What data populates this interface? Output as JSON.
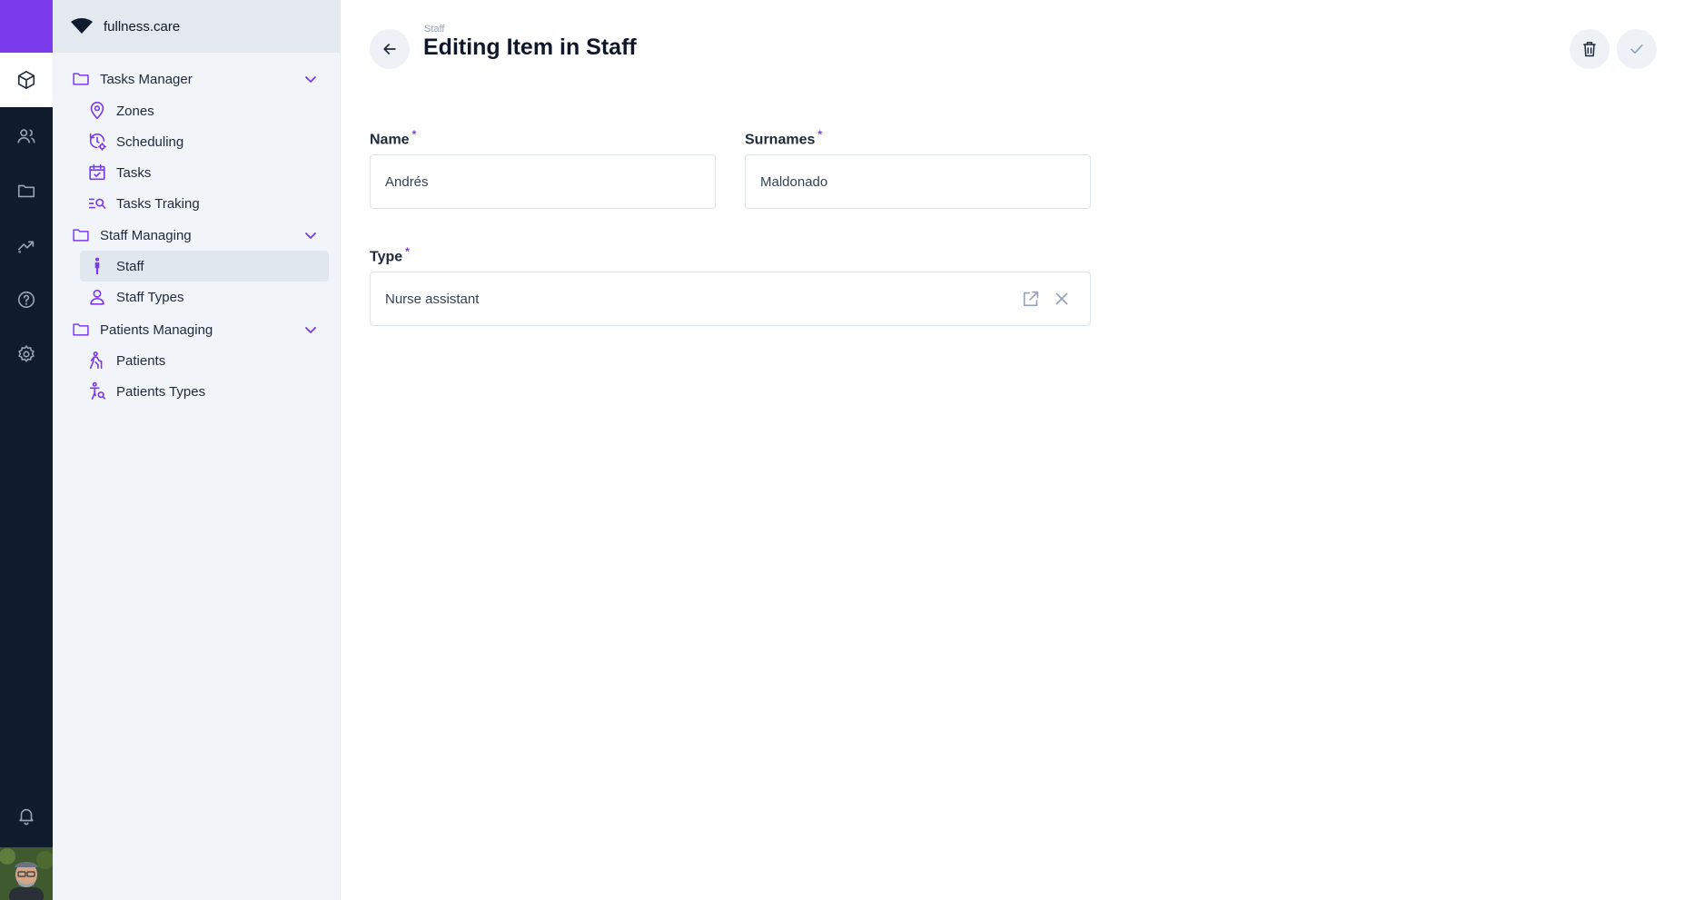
{
  "rail": {
    "items": [
      {
        "icon": "cube-icon",
        "active": true
      },
      {
        "icon": "users-icon",
        "active": false
      },
      {
        "icon": "folder-icon",
        "active": false
      },
      {
        "icon": "analytics-icon",
        "active": false
      },
      {
        "icon": "help-icon",
        "active": false
      },
      {
        "icon": "settings-icon",
        "active": false
      }
    ],
    "bottom": {
      "bell": "bell-icon",
      "avatar": "user-avatar"
    }
  },
  "sidebar": {
    "org": "fullness.care",
    "groups": [
      {
        "label": "Tasks Manager",
        "items": [
          {
            "label": "Zones",
            "icon": "map-pin-icon"
          },
          {
            "label": "Scheduling",
            "icon": "clock-gear-icon"
          },
          {
            "label": "Tasks",
            "icon": "calendar-check-icon"
          },
          {
            "label": "Tasks Traking",
            "icon": "list-search-icon"
          }
        ]
      },
      {
        "label": "Staff Managing",
        "items": [
          {
            "label": "Staff",
            "icon": "person-icon",
            "active": true
          },
          {
            "label": "Staff Types",
            "icon": "user-outline-icon"
          }
        ]
      },
      {
        "label": "Patients Managing",
        "items": [
          {
            "label": "Patients",
            "icon": "walking-person-icon"
          },
          {
            "label": "Patients Types",
            "icon": "person-search-icon"
          }
        ]
      }
    ]
  },
  "header": {
    "breadcrumb": "Staff",
    "title": "Editing Item in Staff"
  },
  "form": {
    "name_label": "Name",
    "name_value": "Andrés",
    "surnames_label": "Surnames",
    "surnames_value": "Maldonado",
    "type_label": "Type",
    "type_value": "Nurse assistant",
    "required_marker": "*"
  },
  "colors": {
    "accent": "#7c3aed",
    "rail_bg": "#0f1c2e",
    "sidebar_bg": "#f1f4f8"
  }
}
